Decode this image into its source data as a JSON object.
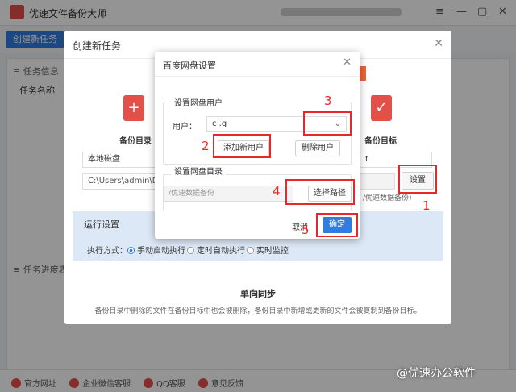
{
  "app": {
    "title": "优速文件备份大师",
    "window_controls": [
      "≡",
      "—",
      "▢",
      "✕"
    ]
  },
  "toolbar": {
    "new_task_label": "创建新任务"
  },
  "background": {
    "tasks_header": "≡ 任务信息（仅",
    "task_name_col": "任务名称",
    "progress_header": "≡ 任务进度表（"
  },
  "create_dialog": {
    "title": "创建新任务",
    "close": "✕",
    "backup_dir_label": "备份目录",
    "backup_target_label": "备份目标",
    "local_disk_value": "本地磁盘",
    "local_path_value": "C:\\Users\\admin\\Desk",
    "target_select_value": "t",
    "settings_button": "设置",
    "target_hint": "/优速数据备份)",
    "run_settings_title": "运行设置",
    "exec_mode_label": "执行方式：",
    "exec_options": [
      "手动启动执行",
      "定时自动执行",
      "实时监控"
    ],
    "sync_title": "单向同步",
    "sync_desc": "备份目录中删除的文件在备份目标中也会被删除，备份目录中新增或更新的文件会被复制到备份目标。"
  },
  "baidu_dialog": {
    "title": "百度网盘设置",
    "close": "✕",
    "user_group_label": "设置网盘用户",
    "user_label": "用户：",
    "user_value": "c          .g",
    "add_user_button": "添加新用户",
    "delete_user_button": "删除用户",
    "dir_group_label": "设置网盘目录",
    "path_placeholder": "/优速数据备份",
    "choose_path_button": "选择路径",
    "cancel_button": "取消",
    "ok_button": "确定"
  },
  "annotations": [
    "1",
    "2",
    "3",
    "4",
    "5"
  ],
  "footer": {
    "items": [
      "官方网址",
      "企业微信客服",
      "QQ客服",
      "意见反馈"
    ],
    "watermark": "@优速办公软件"
  },
  "colors": {
    "accent": "#2f7de1",
    "annotation_red": "#e82828",
    "brand_red": "#e2504a",
    "run_panel_bg": "#dde8f6"
  }
}
